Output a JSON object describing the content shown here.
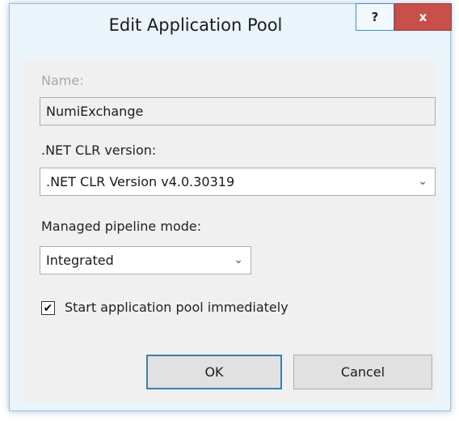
{
  "dialog": {
    "title": "Edit Application Pool",
    "help_label": "?",
    "close_label": "x"
  },
  "form": {
    "name_label": "Name:",
    "name_value": "NumiExchange",
    "clr_label": ".NET CLR version:",
    "clr_value": ".NET CLR Version v4.0.30319",
    "pipeline_label": "Managed pipeline mode:",
    "pipeline_value": "Integrated",
    "start_immediately_label": "Start application pool immediately",
    "start_immediately_checked": true,
    "checkmark": "✔"
  },
  "buttons": {
    "ok_label": "OK",
    "cancel_label": "Cancel"
  },
  "icons": {
    "dropdown": "chevron-down-icon",
    "chevron_glyph": "⌄"
  }
}
